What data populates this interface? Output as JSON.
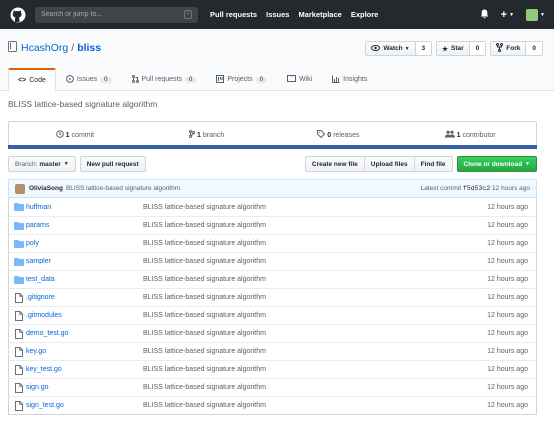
{
  "topbar": {
    "search_placeholder": "Search or jump to...",
    "search_key": "/",
    "nav": [
      "Pull requests",
      "Issues",
      "Marketplace",
      "Explore"
    ],
    "plus": "+"
  },
  "repo": {
    "owner": "HcashOrg",
    "sep": "/",
    "name": "bliss",
    "watch_label": "Watch",
    "watch_count": "3",
    "star_label": "Star",
    "star_count": "0",
    "fork_label": "Fork",
    "fork_count": "0"
  },
  "tabs": [
    {
      "label": "Code",
      "icon": "code-icon"
    },
    {
      "label": "Issues",
      "count": "0",
      "icon": "issue-icon"
    },
    {
      "label": "Pull requests",
      "count": "0",
      "icon": "pull-request-icon"
    },
    {
      "label": "Projects",
      "count": "0",
      "icon": "project-icon"
    },
    {
      "label": "Wiki",
      "icon": "wiki-icon"
    },
    {
      "label": "Insights",
      "icon": "graph-icon"
    }
  ],
  "description": "BLISS lattice-based signature algorithm",
  "summary": {
    "commits_num": "1",
    "commits_label": "commit",
    "branches_num": "1",
    "branches_label": "branch",
    "releases_num": "0",
    "releases_label": "releases",
    "contributors_num": "1",
    "contributors_label": "contributor"
  },
  "filebar": {
    "branch_label": "Branch:",
    "branch_value": "master",
    "new_pr": "New pull request",
    "create_file": "Create new file",
    "upload_files": "Upload files",
    "find_file": "Find file",
    "clone": "Clone or download"
  },
  "commit": {
    "author": "OliviaSong",
    "message": "BLISS lattice-based signature algorithm",
    "latest_label": "Latest commit",
    "sha": "f5d53c2",
    "age": "12 hours ago"
  },
  "files": [
    {
      "name": "huffman",
      "type": "dir",
      "message": "BLISS lattice-based signature algorithm",
      "age": "12 hours ago"
    },
    {
      "name": "params",
      "type": "dir",
      "message": "BLISS lattice-based signature algorithm",
      "age": "12 hours ago"
    },
    {
      "name": "poly",
      "type": "dir",
      "message": "BLISS lattice-based signature algorithm",
      "age": "12 hours ago"
    },
    {
      "name": "sampler",
      "type": "dir",
      "message": "BLISS lattice-based signature algorithm",
      "age": "12 hours ago"
    },
    {
      "name": "test_data",
      "type": "dir",
      "message": "BLISS lattice-based signature algorithm",
      "age": "12 hours ago"
    },
    {
      "name": ".gitignore",
      "type": "file",
      "message": "BLISS lattice-based signature algorithm",
      "age": "12 hours ago"
    },
    {
      "name": ".gitmodules",
      "type": "file",
      "message": "BLISS lattice-based signature algorithm",
      "age": "12 hours ago"
    },
    {
      "name": "demo_test.go",
      "type": "file",
      "message": "BLISS lattice-based signature algorithm",
      "age": "12 hours ago"
    },
    {
      "name": "key.go",
      "type": "file",
      "message": "BLISS lattice-based signature algorithm",
      "age": "12 hours ago"
    },
    {
      "name": "key_test.go",
      "type": "file",
      "message": "BLISS lattice-based signature algorithm",
      "age": "12 hours ago"
    },
    {
      "name": "sign.go",
      "type": "file",
      "message": "BLISS lattice-based signature algorithm",
      "age": "12 hours ago"
    },
    {
      "name": "sign_test.go",
      "type": "file",
      "message": "BLISS lattice-based signature algorithm",
      "age": "12 hours ago"
    }
  ],
  "colors": {
    "topbar": "#24292e",
    "link": "#0366d6",
    "clone": "#28a745",
    "langbar": "#375eab",
    "active_tab": "#e36209"
  }
}
